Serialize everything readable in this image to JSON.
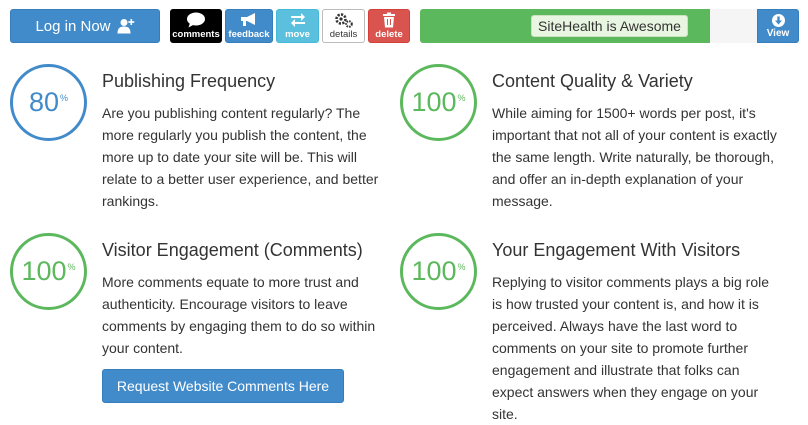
{
  "toolbar": {
    "login_label": "Log in Now",
    "tools": [
      {
        "label": "comments",
        "icon": "speech-bubble-icon"
      },
      {
        "label": "feedback",
        "icon": "megaphone-icon"
      },
      {
        "label": "move",
        "icon": "swap-arrows-icon"
      },
      {
        "label": "details",
        "icon": "gears-icon"
      },
      {
        "label": "delete",
        "icon": "trash-icon"
      }
    ],
    "health_text": "SiteHealth is Awesome",
    "health_progress": 0.86,
    "view_label": "View"
  },
  "colors": {
    "primary": "#428bca",
    "success": "#5cb85c",
    "info": "#5bc0de",
    "danger": "#d9534f"
  },
  "sections": [
    {
      "score": "80",
      "unit": "%",
      "title": "Publishing Frequency",
      "body": "Are you publishing content regularly? The more regularly you publish the content, the more up to date your site will be. This will relate to a better user experience, and better rankings."
    },
    {
      "score": "100",
      "unit": "%",
      "title": "Content Quality & Variety",
      "body": "While aiming for 1500+ words per post, it's important that not all of your content is exactly the same length. Write naturally, be thorough, and offer an in-depth explanation of your message."
    },
    {
      "score": "100",
      "unit": "%",
      "title": "Visitor Engagement (Comments)",
      "body": "More comments equate to more trust and authenticity. Encourage visitors to leave comments by engaging them to do so within your content.",
      "button_label": "Request Website Comments Here"
    },
    {
      "score": "100",
      "unit": "%",
      "title": "Your Engagement With Visitors",
      "body": "Replying to visitor comments plays a big role is how trusted your content is, and how it is perceived. Always have the last word to comments on your site to promote further engagement and illustrate that folks can expect answers when they engage on your site."
    }
  ]
}
